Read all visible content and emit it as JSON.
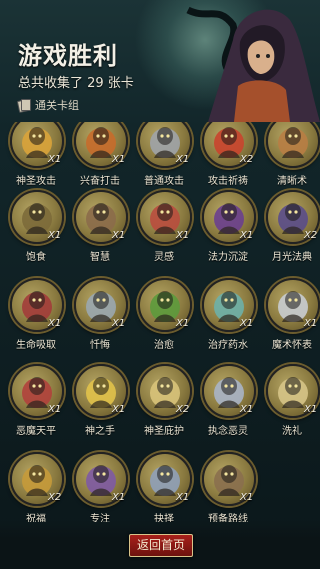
{
  "header": {
    "title": "游戏胜利",
    "subtitle": "总共收集了 29 张卡",
    "deck_label": "通关卡组"
  },
  "cards": [
    {
      "name": "神圣攻击",
      "count": "X1",
      "icon": "holy-strike-icon",
      "color": "#d9a33a"
    },
    {
      "name": "兴奋打击",
      "count": "X1",
      "icon": "excited-strike-icon",
      "color": "#c76b2b"
    },
    {
      "name": "普通攻击",
      "count": "X1",
      "icon": "normal-attack-icon",
      "color": "#9ea3a8"
    },
    {
      "name": "攻击祈祷",
      "count": "X2",
      "icon": "attack-prayer-icon",
      "color": "#c9442d"
    },
    {
      "name": "清晰术",
      "count": "",
      "icon": "clarity-icon",
      "color": "#b87d44"
    },
    {
      "name": "饱食",
      "count": "X1",
      "icon": "satiety-icon",
      "color": "#7c6a3a"
    },
    {
      "name": "智慧",
      "count": "X1",
      "icon": "wisdom-icon",
      "color": "#8b6b4a"
    },
    {
      "name": "灵感",
      "count": "X1",
      "icon": "inspiration-icon",
      "color": "#b94d3e"
    },
    {
      "name": "法力沉淀",
      "count": "X1",
      "icon": "mana-icon",
      "color": "#6a3f8e"
    },
    {
      "name": "月光法典",
      "count": "X2",
      "icon": "moon-tome-icon",
      "color": "#5a4d8a"
    },
    {
      "name": "生命吸取",
      "count": "X1",
      "icon": "life-drain-icon",
      "color": "#a23c3a"
    },
    {
      "name": "忏悔",
      "count": "X1",
      "icon": "repent-icon",
      "color": "#9aa7b0"
    },
    {
      "name": "治愈",
      "count": "X1",
      "icon": "heal-icon",
      "color": "#5c9a3c"
    },
    {
      "name": "治疗药水",
      "count": "X1",
      "icon": "potion-icon",
      "color": "#6db0a8"
    },
    {
      "name": "魔术怀表",
      "count": "X1",
      "icon": "pocket-watch-icon",
      "color": "#c8ccd0"
    },
    {
      "name": "恶魔天平",
      "count": "X1",
      "icon": "demon-scale-icon",
      "color": "#b0413c"
    },
    {
      "name": "神之手",
      "count": "X1",
      "icon": "god-hand-icon",
      "color": "#e1c24a"
    },
    {
      "name": "神圣庇护",
      "count": "X2",
      "icon": "holy-shield-icon",
      "color": "#d8c37a"
    },
    {
      "name": "执念恶灵",
      "count": "X1",
      "icon": "wraith-icon",
      "color": "#a8b4c6"
    },
    {
      "name": "洗礼",
      "count": "X1",
      "icon": "baptism-icon",
      "color": "#d6c487"
    },
    {
      "name": "祝福",
      "count": "X2",
      "icon": "blessing-icon",
      "color": "#c59a3a"
    },
    {
      "name": "专注",
      "count": "X1",
      "icon": "focus-icon",
      "color": "#7e5aa3"
    },
    {
      "name": "抉择",
      "count": "X1",
      "icon": "choice-icon",
      "color": "#8fa0b8"
    },
    {
      "name": "预备路线",
      "count": "X1",
      "icon": "route-icon",
      "color": "#8a6f4e"
    }
  ],
  "footer": {
    "back_label": "返回首页"
  }
}
